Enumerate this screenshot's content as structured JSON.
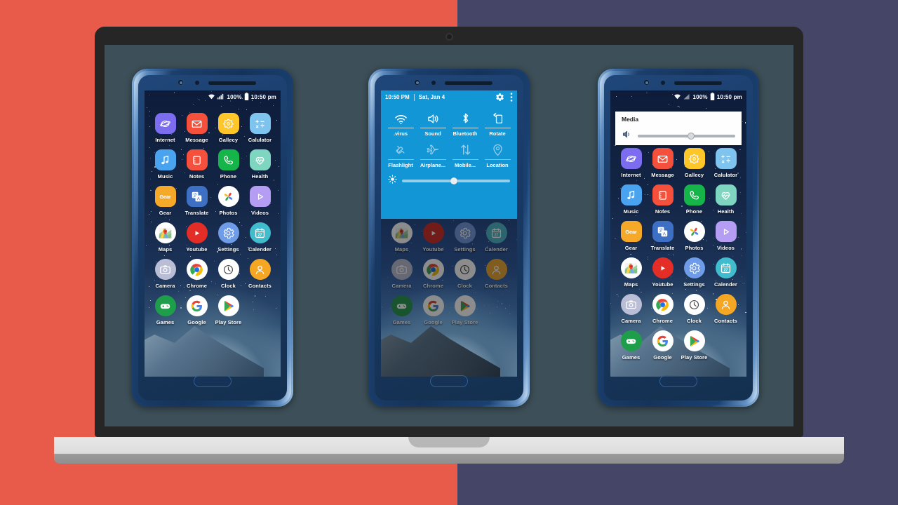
{
  "background": {
    "left_color": "#E85A4A",
    "right_color": "#454568"
  },
  "device": {
    "name": "laptop-mockup",
    "bezel_color": "#262626",
    "screen_color": "#3D4F58",
    "base_color": "#e0e0e0"
  },
  "phones": [
    {
      "id": "phone-left",
      "state": "home-screen",
      "statusbar": {
        "wifi": "wifi-icon",
        "signal": "signal-icon",
        "battery_text": "100%",
        "battery": "battery-icon",
        "time": "10:50 pm"
      }
    },
    {
      "id": "phone-center",
      "state": "quick-settings-open",
      "quick_settings": {
        "time": "10:50 PM",
        "date": "Sat, Jan 4",
        "gear": "gear-icon",
        "overflow": "more-vertical-icon",
        "tiles": [
          {
            "label": ".virus",
            "icon": "wifi-icon",
            "active": true
          },
          {
            "label": "Sound",
            "icon": "volume-icon",
            "active": true
          },
          {
            "label": "Bluetooth",
            "icon": "bluetooth-icon",
            "active": true
          },
          {
            "label": "Rotate",
            "icon": "rotate-icon",
            "active": true
          },
          {
            "label": "Flashlight",
            "icon": "flashlight-icon",
            "active": false
          },
          {
            "label": "Airplane...",
            "icon": "airplane-icon",
            "active": false
          },
          {
            "label": "Mobile...",
            "icon": "data-transfer-icon",
            "active": false
          },
          {
            "label": "Location",
            "icon": "location-pin-icon",
            "active": false
          }
        ],
        "brightness": {
          "icon": "brightness-icon",
          "value_percent": 48
        }
      }
    },
    {
      "id": "phone-right",
      "state": "media-volume-popup",
      "statusbar": {
        "wifi": "wifi-icon",
        "signal": "signal-icon",
        "battery_text": "100%",
        "battery": "battery-icon",
        "time": "10:50 pm"
      },
      "media_popup": {
        "title": "Media",
        "icon": "speaker-icon",
        "value_percent": 55
      }
    }
  ],
  "apps": [
    {
      "label": "Internet",
      "icon": "internet-icon",
      "shape": "squircle",
      "bg": "#7b6cf0"
    },
    {
      "label": "Message",
      "icon": "message-icon",
      "shape": "squircle",
      "bg": "#f4503c"
    },
    {
      "label": "Gallecy",
      "icon": "gallery-icon",
      "shape": "squircle",
      "bg": "#ffc629"
    },
    {
      "label": "Calulator",
      "icon": "calculator-icon",
      "shape": "squircle",
      "bg": "#7fc3ef"
    },
    {
      "label": "Music",
      "icon": "music-note-icon",
      "shape": "squircle",
      "bg": "#4aa3ef"
    },
    {
      "label": "Notes",
      "icon": "notes-icon",
      "shape": "squircle",
      "bg": "#f4503c"
    },
    {
      "label": "Phone",
      "icon": "phone-icon",
      "shape": "squircle",
      "bg": "#15b54a"
    },
    {
      "label": "Health",
      "icon": "health-icon",
      "shape": "squircle",
      "bg": "#7fd6c0"
    },
    {
      "label": "Gear",
      "icon": "gear-app-icon",
      "shape": "squircle",
      "bg": "#f6a928"
    },
    {
      "label": "Translate",
      "icon": "translate-icon",
      "shape": "squircle",
      "bg": "#3d6fc4"
    },
    {
      "label": "Photos",
      "icon": "photos-icon",
      "shape": "round",
      "bg": "#ffffff"
    },
    {
      "label": "Videos",
      "icon": "videos-icon",
      "shape": "squircle",
      "bg": "#b59df3"
    },
    {
      "label": "Maps",
      "icon": "maps-icon",
      "shape": "round",
      "bg": "#ffffff"
    },
    {
      "label": "Youtube",
      "icon": "youtube-icon",
      "shape": "round",
      "bg": "#e52d27"
    },
    {
      "label": "Settings",
      "icon": "settings-icon",
      "shape": "round",
      "bg": "#6f9ce8"
    },
    {
      "label": "Calender",
      "icon": "calendar-icon",
      "shape": "round",
      "bg": "#41bccd"
    },
    {
      "label": "Camera",
      "icon": "camera-icon",
      "shape": "round",
      "bg": "#b9bdd6"
    },
    {
      "label": "Chrome",
      "icon": "chrome-icon",
      "shape": "round",
      "bg": "#ffffff"
    },
    {
      "label": "Clock",
      "icon": "clock-icon",
      "shape": "round",
      "bg": "#ffffff"
    },
    {
      "label": "Contacts",
      "icon": "contacts-icon",
      "shape": "round",
      "bg": "#f5a623"
    },
    {
      "label": "Games",
      "icon": "games-icon",
      "shape": "round",
      "bg": "#1e9e4a"
    },
    {
      "label": "Google",
      "icon": "google-icon",
      "shape": "round",
      "bg": "#ffffff"
    },
    {
      "label": "Play Store",
      "icon": "play-store-icon",
      "shape": "round",
      "bg": "#ffffff"
    }
  ]
}
